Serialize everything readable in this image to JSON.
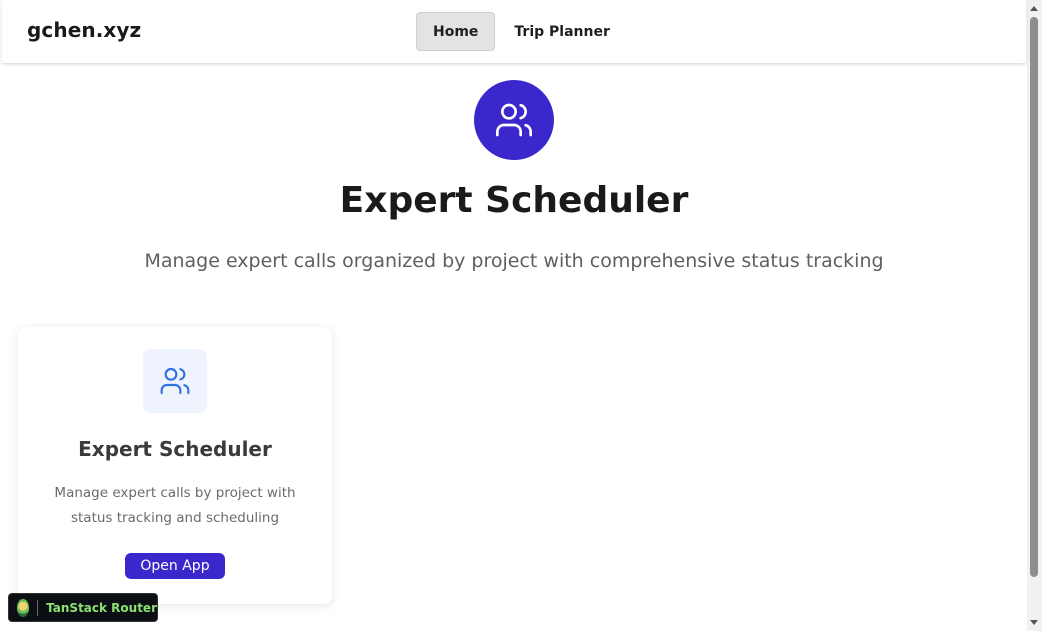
{
  "header": {
    "brand": "gchen.xyz",
    "nav": [
      {
        "label": "Home",
        "active": true
      },
      {
        "label": "Trip Planner",
        "active": false
      }
    ]
  },
  "hero": {
    "icon": "users-icon",
    "title": "Expert Scheduler",
    "subtitle": "Manage expert calls organized by project with comprehensive status tracking"
  },
  "card": {
    "icon": "users-icon",
    "title": "Expert Scheduler",
    "description": "Manage expert calls by project with status tracking and scheduling",
    "button_label": "Open App"
  },
  "devtools": {
    "label": "TanStack Router",
    "icon": "tanstack-logo-icon"
  },
  "colors": {
    "accent": "#3b28cc",
    "icon_blue": "#2f6fe0",
    "card_icon_bg": "#eef3fe"
  }
}
